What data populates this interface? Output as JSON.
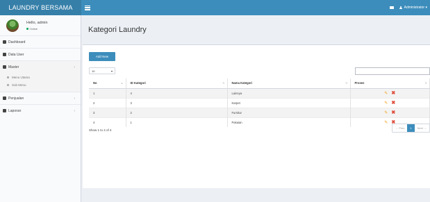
{
  "app": {
    "brand": "LAUNDRY BERSAMA"
  },
  "topbar": {
    "user_label": "Administrator ▾"
  },
  "sidebar": {
    "user_name": "Hello, admin",
    "status": "Online",
    "menu": [
      {
        "label": "Dashboard"
      },
      {
        "label": "Data User"
      },
      {
        "label": "Master",
        "chevron": "‹"
      },
      {
        "label": "Penjualan",
        "chevron": "‹"
      },
      {
        "label": "Laporan",
        "chevron": "‹"
      }
    ],
    "submenu": [
      {
        "label": "Menu Utama"
      },
      {
        "label": "Sub Menu"
      }
    ]
  },
  "page": {
    "title": "Kategori Laundry"
  },
  "toolbar": {
    "add_label": "Add New",
    "page_length": "10",
    "search_value": ""
  },
  "table": {
    "headers": [
      "No",
      "ID Kategori",
      "Nama Kategori",
      "Proses"
    ],
    "rows": [
      {
        "no": "1",
        "id": "4",
        "nama": "Lainnya"
      },
      {
        "no": "2",
        "id": "3",
        "nama": "Karpet"
      },
      {
        "no": "3",
        "id": "2",
        "nama": "Furnitur"
      },
      {
        "no": "4",
        "id": "1",
        "nama": "Pakaian"
      }
    ]
  },
  "footer": {
    "info": "Show 1 to 4 of 4",
    "prev": "← Prev",
    "page": "1",
    "next": "Next →"
  },
  "colors": {
    "header": "#3c8dbc",
    "logo": "#367fa9",
    "edit": "#f39c12",
    "delete": "#dd4b39",
    "online": "#00a65a"
  }
}
